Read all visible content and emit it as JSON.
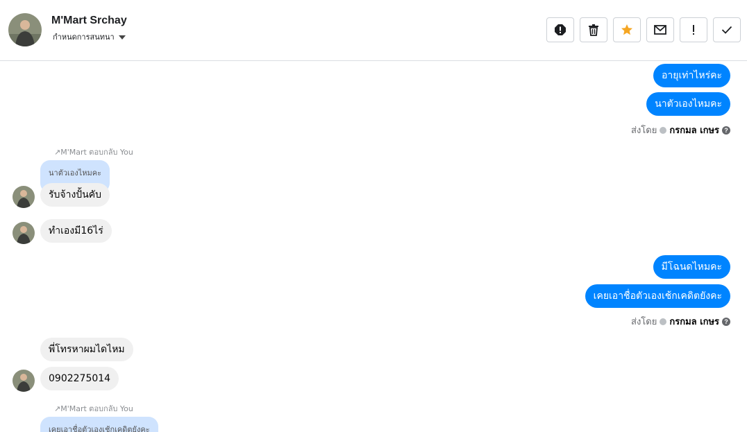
{
  "header": {
    "contact_name": "M'Mart Srchay",
    "label_dropdown": "กำหนดการสนทนา",
    "actions": [
      {
        "name": "spam-alert-icon",
        "color": "#1c1e21"
      },
      {
        "name": "trash-icon",
        "color": "#1c1e21"
      },
      {
        "name": "star-icon",
        "color": "#f5a623"
      },
      {
        "name": "envelope-icon",
        "color": "#1c1e21"
      },
      {
        "name": "exclamation-icon",
        "color": "#1c1e21"
      },
      {
        "name": "check-icon",
        "color": "#1c1e21"
      }
    ]
  },
  "thread": {
    "outgoing_1": "อายุเท่าไหร่คะ",
    "outgoing_2": "นาตัวเองไหมคะ",
    "sent_by_1": {
      "prefix": "ส่งโดย",
      "name": "กรกมล เกษร"
    },
    "reply_note_1": "↗M'Mart ตอบกลับ You",
    "quoted_1": "นาตัวเองไหมคะ",
    "incoming_1": "รับจ้างปั้นคับ",
    "incoming_2": "ทำเองมี16ไร่",
    "outgoing_3": "มีโฉนดไหมคะ",
    "outgoing_4": "เคยเอาชื่อตัวเองเช้กเคดิตยังคะ",
    "sent_by_2": {
      "prefix": "ส่งโดย",
      "name": "กรกมล เกษร"
    },
    "incoming_3": "พี่โทรหาผมไดไหม",
    "incoming_4": "0902275014",
    "reply_note_2": "↗M'Mart ตอบกลับ You",
    "quoted_2": "เคยเอาชื่อตัวเองเช้กเคดิตยังคะ"
  },
  "colors": {
    "outgoing_bubble": "#0084ff",
    "incoming_bubble": "#f0f0f0",
    "quoted_bubble": "#cfe3fe"
  }
}
